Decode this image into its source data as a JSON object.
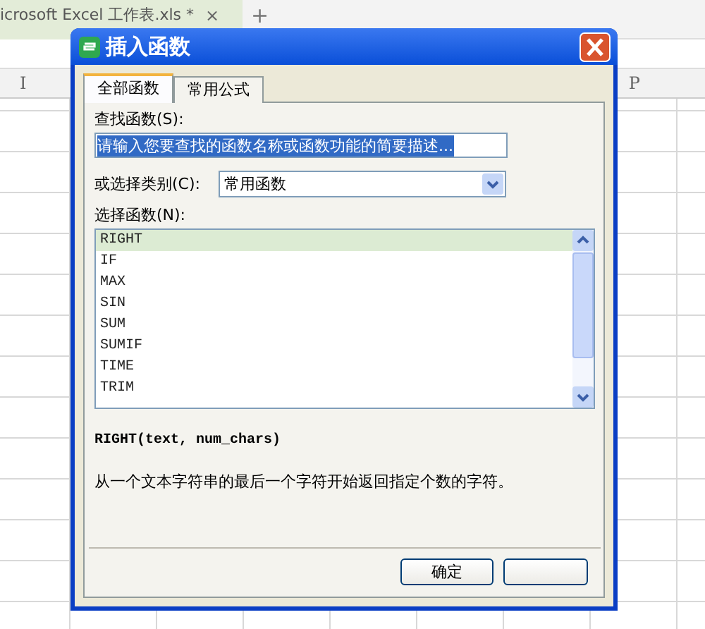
{
  "tab_bar": {
    "tabs": [
      {
        "label": "icrosoft Excel 工作表.xls *",
        "selected": true,
        "close": "×"
      }
    ],
    "new_tab": "+"
  },
  "sheet": {
    "column_headers": [
      "I",
      "P"
    ]
  },
  "dialog": {
    "title": "插入函数",
    "tabs": [
      {
        "label": "全部函数",
        "selected": true
      },
      {
        "label": "常用公式",
        "selected": false
      }
    ],
    "search": {
      "label": "查找函数(S):",
      "value": "请输入您要查找的函数名称或函数功能的简要描述..."
    },
    "category": {
      "label": "或选择类别(C):",
      "value": "常用函数"
    },
    "functions": {
      "label": "选择函数(N):",
      "items": [
        {
          "name": "RIGHT",
          "selected": true
        },
        {
          "name": "IF",
          "selected": false
        },
        {
          "name": "MAX",
          "selected": false
        },
        {
          "name": "SIN",
          "selected": false
        },
        {
          "name": "SUM",
          "selected": false
        },
        {
          "name": "SUMIF",
          "selected": false
        },
        {
          "name": "TIME",
          "selected": false
        },
        {
          "name": "TRIM",
          "selected": false
        }
      ]
    },
    "signature": "RIGHT(text, num_chars)",
    "description": "从一个文本字符串的最后一个字符开始返回指定个数的字符。",
    "buttons": [
      "确定"
    ]
  }
}
